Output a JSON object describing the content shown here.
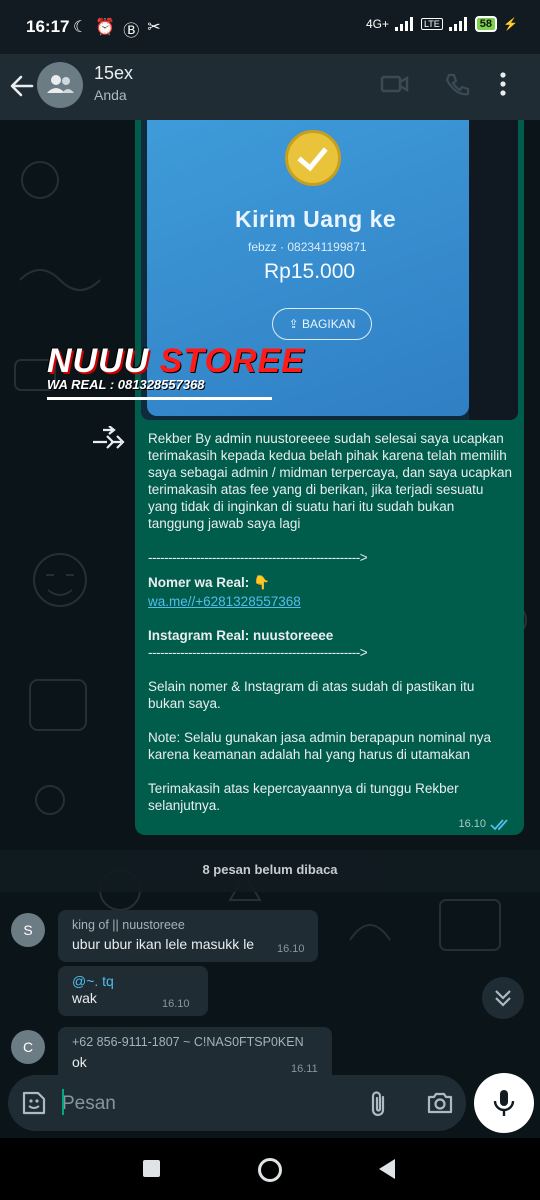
{
  "status": {
    "time": "16:17",
    "network": "4G+",
    "battery": "58"
  },
  "header": {
    "name": "15ex",
    "subtitle": "Anda"
  },
  "outgoing": {
    "photo": {
      "title": "Kirim Uang ke",
      "recipient": "febzz · 082341199871",
      "amount": "Rp15.000",
      "share_label": "BAGIKAN",
      "watermark_a": "NUUU ",
      "watermark_b": "STOREE",
      "watermark_sub": "WA REAL : 081328557368"
    },
    "para1": "Rekber By admin nuustoreeee sudah selesai saya ucapkan terimakasih kepada kedua belah pihak karena telah memilih saya sebagai admin / midman terpercaya, dan saya ucapkan terimakasih atas fee yang di berikan, jika terjadi sesuatu yang tidak di inginkan di suatu hari itu sudah bukan tanggung jawab saya lagi",
    "divider": "----------------------------------------------------->",
    "wa_label": "Nomer wa Real:",
    "wa_emoji": "👇",
    "wa_link": "wa.me//+6281328557368",
    "ig_label": "Instagram Real: nuustoreeee",
    "para2": "Selain nomer & Instagram di atas sudah di pastikan itu bukan saya.",
    "para3": "Note: Selalu gunakan jasa admin berapapun nominal nya karena keamanan adalah hal yang harus di utamakan",
    "para4": "Terimakasih atas kepercayaannya di tunggu Rekber selanjutnya.",
    "time": "16.10"
  },
  "unread": {
    "label": "8 pesan belum dibaca"
  },
  "incoming": [
    {
      "avatar": "S",
      "sender": "king of || nuustoreee",
      "text": "ubur ubur ikan lele masukk le",
      "time": "16.10"
    },
    {
      "mention": "@~. tq",
      "text": "wak",
      "time": "16.10"
    },
    {
      "avatar": "C",
      "sender": "+62 856-9111-1807  ~ C!NAS0FTSP0KEN",
      "text": "ok",
      "time": "16.11"
    }
  ],
  "composer": {
    "placeholder": "Pesan"
  },
  "colors": {
    "outgoing_bubble": "#005c4b",
    "incoming_bubble": "#1f2c34",
    "accent": "#00a884",
    "link": "#53bdeb"
  }
}
